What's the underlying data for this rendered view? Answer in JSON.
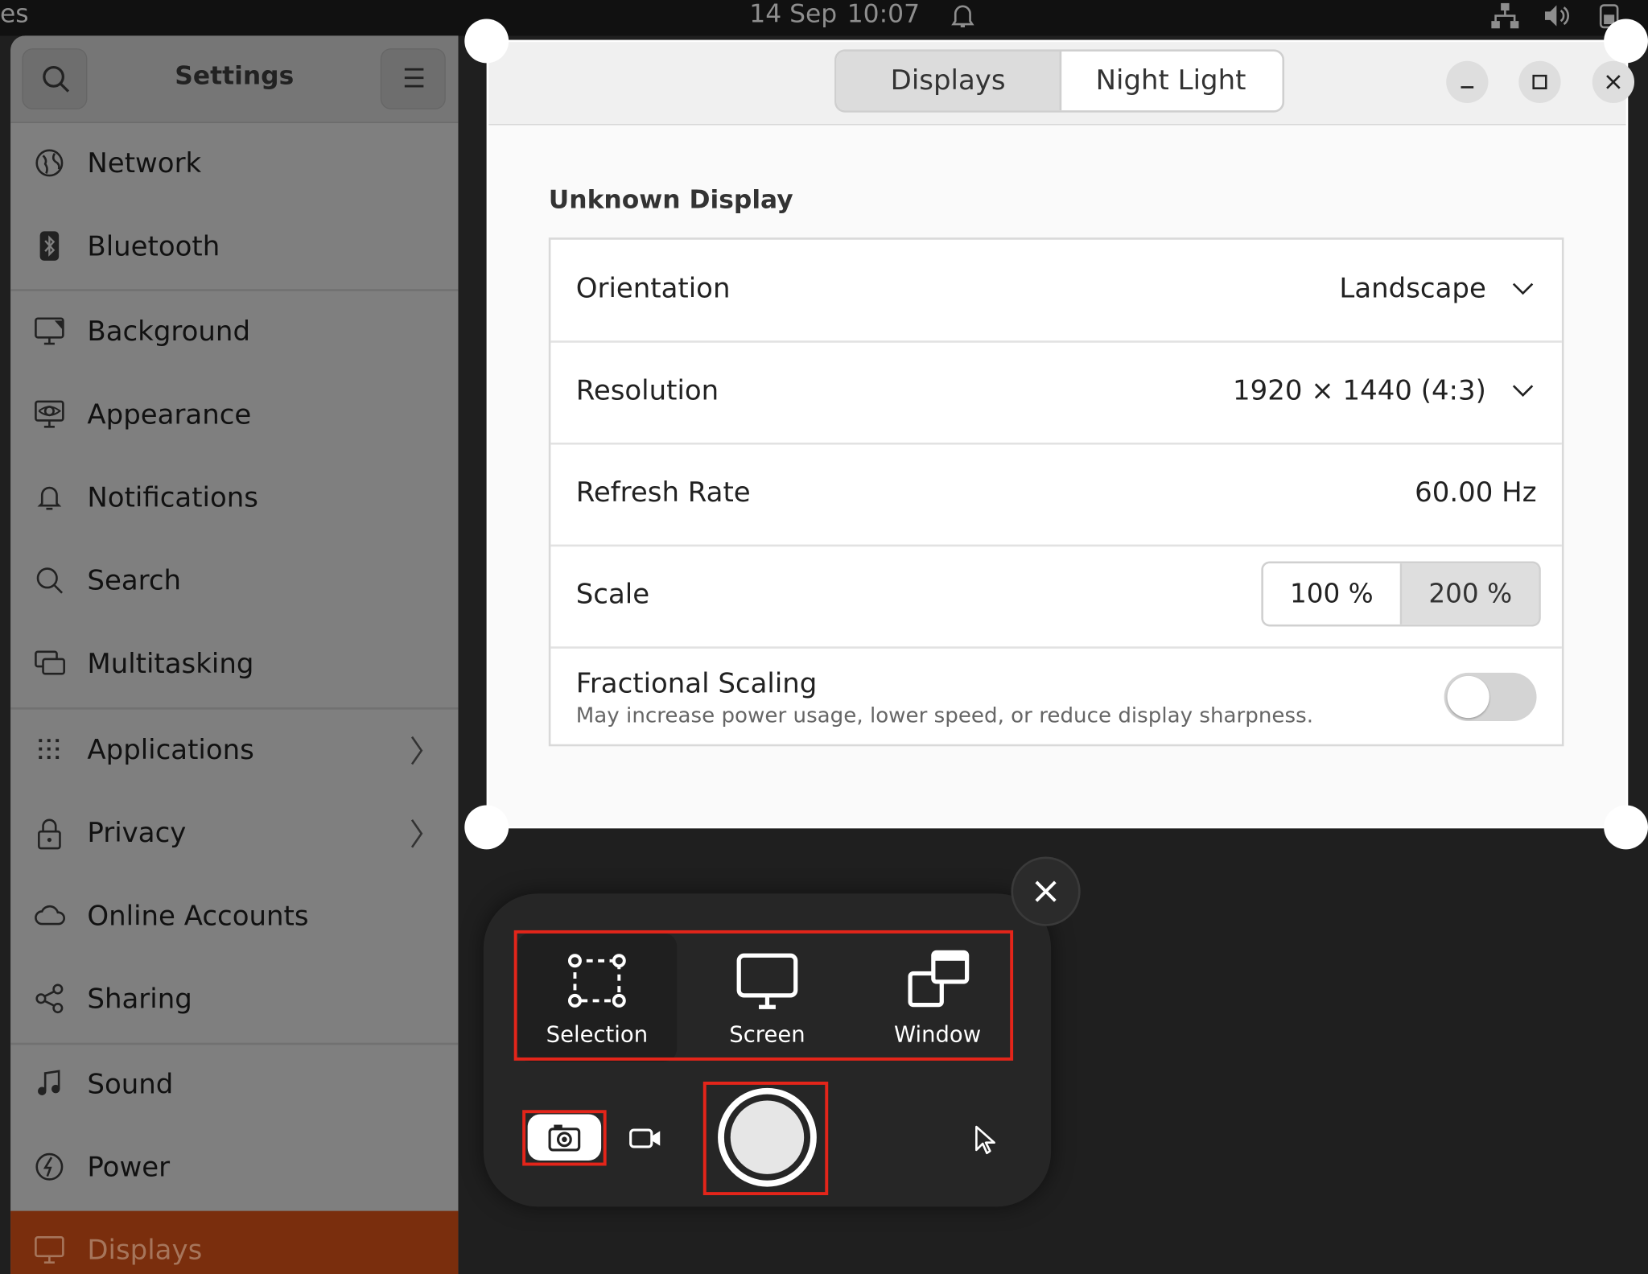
{
  "topbar": {
    "app_fragment": "es",
    "date": "14 Sep",
    "time": "10:07",
    "icons": [
      "bell-icon",
      "network-icon",
      "volume-icon",
      "battery-icon"
    ]
  },
  "sidebar": {
    "title": "Settings",
    "items": [
      {
        "label": "Network",
        "icon": "globe-icon"
      },
      {
        "label": "Bluetooth",
        "icon": "bluetooth-icon"
      },
      {
        "label": "Background",
        "icon": "background-icon"
      },
      {
        "label": "Appearance",
        "icon": "appearance-icon"
      },
      {
        "label": "Notifications",
        "icon": "bell-icon"
      },
      {
        "label": "Search",
        "icon": "search-icon"
      },
      {
        "label": "Multitasking",
        "icon": "multitasking-icon"
      },
      {
        "label": "Applications",
        "icon": "grid-icon"
      },
      {
        "label": "Privacy",
        "icon": "lock-icon"
      },
      {
        "label": "Online Accounts",
        "icon": "cloud-icon"
      },
      {
        "label": "Sharing",
        "icon": "share-icon"
      },
      {
        "label": "Sound",
        "icon": "music-note-icon"
      },
      {
        "label": "Power",
        "icon": "power-icon"
      },
      {
        "label": "Displays",
        "icon": "display-icon"
      }
    ],
    "active": "Displays"
  },
  "header": {
    "tabs": [
      {
        "label": "Displays",
        "selected": true
      },
      {
        "label": "Night Light",
        "selected": false
      }
    ]
  },
  "display": {
    "title": "Unknown Display",
    "orientation": {
      "label": "Orientation",
      "value": "Landscape"
    },
    "resolution": {
      "label": "Resolution",
      "value": "1920 × 1440 (4:3)"
    },
    "refresh": {
      "label": "Refresh Rate",
      "value": "60.00 Hz"
    },
    "scale": {
      "label": "Scale",
      "options": [
        "100 %",
        "200 %"
      ],
      "selected": "200 %"
    },
    "fractional": {
      "label": "Fractional Scaling",
      "description": "May increase power usage, lower speed, or reduce display sharpness.",
      "enabled": false
    }
  },
  "screenshot_ui": {
    "modes": [
      {
        "label": "Selection",
        "selected": true
      },
      {
        "label": "Screen",
        "selected": false
      },
      {
        "label": "Window",
        "selected": false
      }
    ],
    "capture_type": "screenshot",
    "highlight_color": "#e3251a"
  },
  "colors": {
    "accent": "#7a2e0d",
    "highlight": "#e3251a"
  }
}
